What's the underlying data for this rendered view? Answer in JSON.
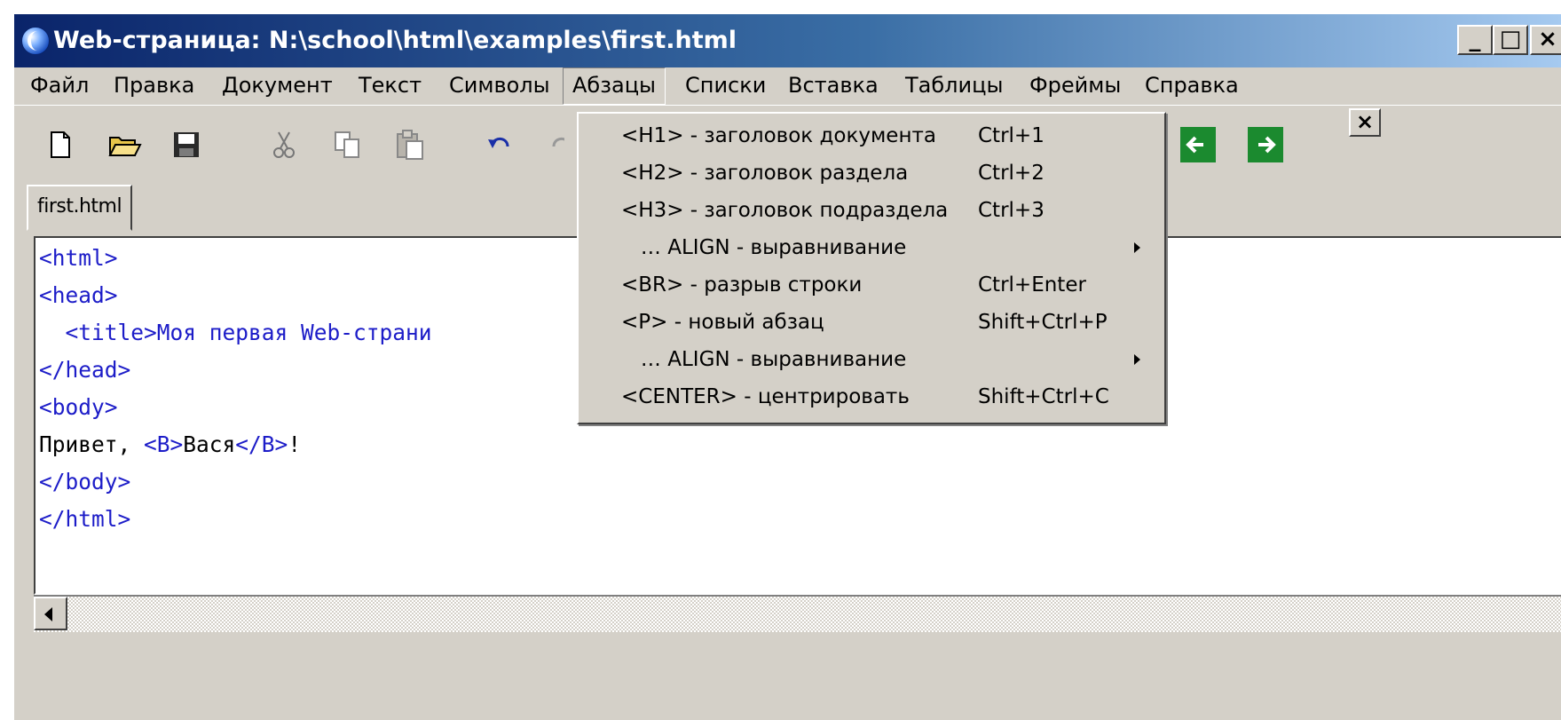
{
  "window": {
    "title": "Web-страница: N:\\school\\html\\examples\\first.html",
    "controls": {
      "minimize": "_",
      "maximize": "□",
      "close": "×"
    }
  },
  "menubar": {
    "items": [
      "Файл",
      "Правка",
      "Документ",
      "Текст",
      "Символы",
      "Абзацы",
      "Списки",
      "Вставка",
      "Таблицы",
      "Фреймы",
      "Справка"
    ],
    "active": "Абзацы"
  },
  "toolbar": {
    "buttons": [
      "new-document-icon",
      "open-folder-icon",
      "save-icon",
      "cut-icon",
      "copy-icon",
      "paste-icon",
      "undo-icon",
      "redo-icon",
      "back-arrow-icon",
      "forward-arrow-icon"
    ],
    "close_label": "×",
    "colors": {
      "nav_arrow_bg": "#1b8a2f"
    }
  },
  "tabs": {
    "active": "first.html"
  },
  "editor": {
    "lines": [
      "<html>",
      "<head>",
      "  <title>Моя первая Web-страни",
      "</head>",
      "<body>",
      "Привет, <B>Вася</B>!",
      "</body>",
      "</html>"
    ],
    "colors": {
      "tag": "#1c1cc8",
      "text": "#000000"
    }
  },
  "paragraph_menu": {
    "items": [
      {
        "label": "<H1> - заголовок документа",
        "shortcut": "Ctrl+1"
      },
      {
        "label": "<H2> - заголовок раздела",
        "shortcut": "Ctrl+2"
      },
      {
        "label": "<H3> - заголовок подраздела",
        "shortcut": "Ctrl+3"
      },
      {
        "label": "   … ALIGN - выравнивание",
        "shortcut": "",
        "submenu": true
      },
      {
        "label": "<BR> - разрыв строки",
        "shortcut": "Ctrl+Enter"
      },
      {
        "label": "<P> - новый абзац",
        "shortcut": "Shift+Ctrl+P"
      },
      {
        "label": "   … ALIGN - выравнивание",
        "shortcut": "",
        "submenu": true
      },
      {
        "label": "<CENTER> - центрировать",
        "shortcut": "Shift+Ctrl+C"
      }
    ]
  },
  "colors": {
    "window_bg": "#d4d0c8",
    "titlebar_start": "#0a246a",
    "titlebar_end": "#a6caf0"
  }
}
